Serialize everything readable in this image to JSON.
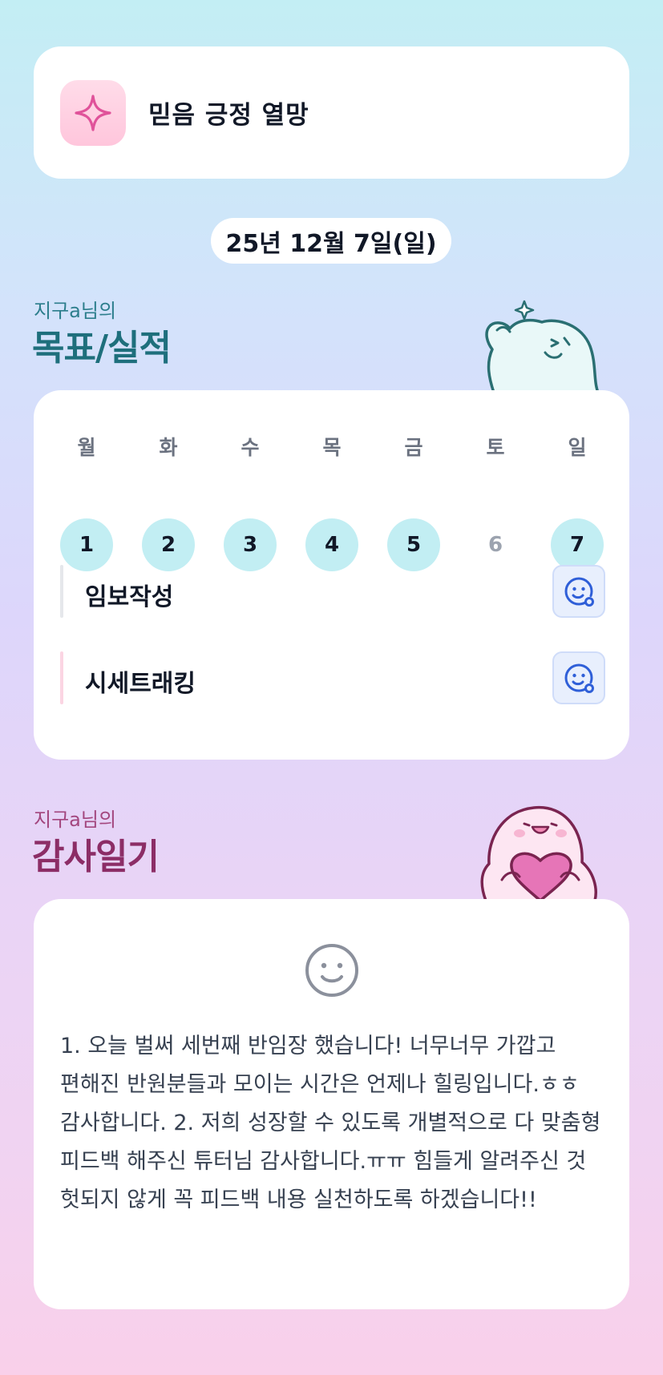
{
  "header": {
    "title": "믿음 긍정 열망",
    "icon": "sparkle-icon"
  },
  "date": "25년 12월 7일(일)",
  "goals": {
    "subtitle": "지구a님의",
    "title": "목표/실적",
    "week": [
      {
        "day": "월",
        "num": "1",
        "active": true
      },
      {
        "day": "화",
        "num": "2",
        "active": true
      },
      {
        "day": "수",
        "num": "3",
        "active": true
      },
      {
        "day": "목",
        "num": "4",
        "active": true
      },
      {
        "day": "금",
        "num": "5",
        "active": true
      },
      {
        "day": "토",
        "num": "6",
        "active": false
      },
      {
        "day": "일",
        "num": "7",
        "active": true
      }
    ],
    "tasks": [
      {
        "label": "임보작성",
        "bar_color": "#e5e7eb",
        "icon": "smiley-add-icon"
      },
      {
        "label": "시세트래킹",
        "bar_color": "#fbd5e3",
        "icon": "smiley-add-icon"
      }
    ]
  },
  "gratitude": {
    "subtitle": "지구a님의",
    "title": "감사일기",
    "icon": "smiley-icon",
    "text": "1. 오늘 벌써 세번째 반임장 했습니다! 너무너무 가깝고 편해진 반원분들과 모이는 시간은 언제나 힐링입니다.ㅎㅎ 감사합니다. 2. 저희 성장할 수 있도록 개별적으로 다 맞춤형 피드백 해주신 튜터님 감사합니다.ㅠㅠ 힘들게 알려주신 것 헛되지 않게 꼭 피드백 내용 실천하도록 하겠습니다!!"
  },
  "colors": {
    "active_day": "#c2eef3",
    "goal_title": "#1e6f7c",
    "gratitude_title": "#8c2d66"
  }
}
